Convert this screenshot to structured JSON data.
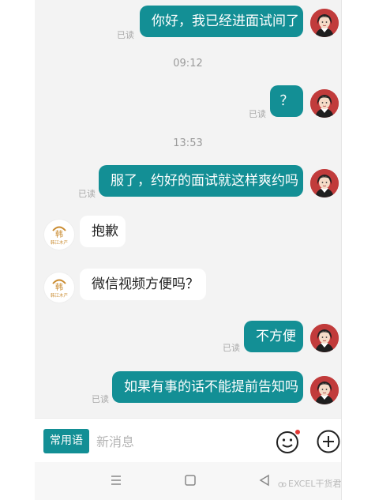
{
  "messages": [
    {
      "id": 1,
      "side": "out",
      "text": "你好，我已经进面试间了",
      "read": "已读"
    },
    {
      "id": 2,
      "side": "out",
      "text": "？",
      "read": "已读"
    },
    {
      "id": 3,
      "side": "out",
      "text": "服了，约好的面试就这样爽约吗",
      "read": "已读"
    },
    {
      "id": 4,
      "side": "in",
      "text": "抱歉"
    },
    {
      "id": 5,
      "side": "in",
      "text": "微信视频方便吗？"
    },
    {
      "id": 6,
      "side": "out",
      "text": "不方便",
      "read": "已读"
    },
    {
      "id": 7,
      "side": "out",
      "text": "如果有事的话不能提前告知吗",
      "read": "已读"
    }
  ],
  "timestamps": {
    "first": "09:12",
    "second": "13:53"
  },
  "shop_avatar_text": "韩江木产",
  "input_bar": {
    "quick_reply_label": "常用语",
    "placeholder": "新消息"
  },
  "colors": {
    "accent": "#138f95",
    "chat_bg": "#f3f3f3",
    "avatar_red": "#c13b3b",
    "notification_dot": "#e53935"
  },
  "icons": {
    "emoji": "smiley-face-icon",
    "plus": "plus-circle-icon",
    "nav_menu": "menu-icon",
    "nav_home": "home-square-icon",
    "nav_back": "back-triangle-icon"
  },
  "watermark": "EXCEL干货君"
}
